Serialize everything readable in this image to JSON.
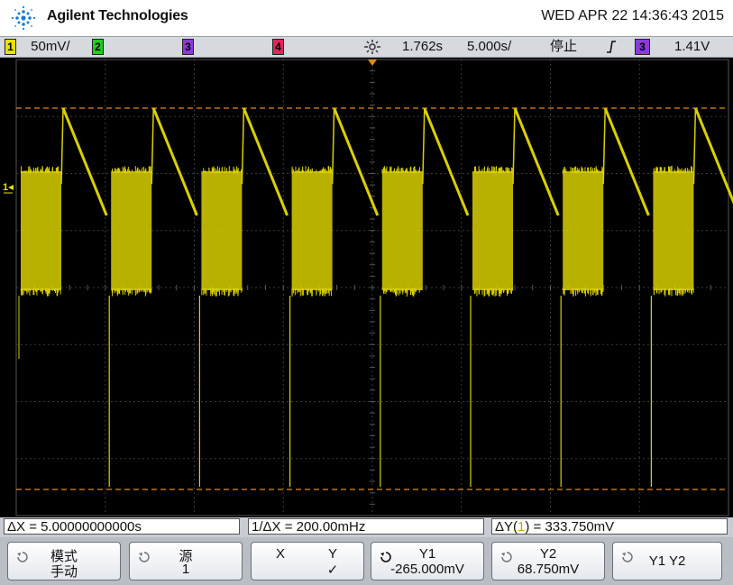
{
  "header": {
    "brand": "Agilent Technologies",
    "datetime": "WED APR 22 14:36:43 2015"
  },
  "statusbar": {
    "ch1": {
      "num": "1",
      "scale": "50mV/"
    },
    "ch2": {
      "num": "2"
    },
    "ch3": {
      "num": "3"
    },
    "ch4": {
      "num": "4"
    },
    "time_delay": "1.762s",
    "time_scale": "5.000s/",
    "run_state": "停止",
    "trigger_slope": "Ⅎ",
    "trigger_source": "3",
    "trigger_level": "1.41V"
  },
  "screen": {
    "ground_marker": "1"
  },
  "measurements": {
    "delta_x": "ΔX = 5.00000000000s",
    "inv_delta_x": "1/ΔX = 200.00mHz",
    "delta_y_prefix": "ΔY(",
    "delta_y_ch": "1",
    "delta_y_suffix": ") = 333.750mV"
  },
  "softkeys": [
    {
      "line1": "模式",
      "line2": "手动"
    },
    {
      "line1": "源",
      "line2": "1"
    },
    {
      "line1": "X",
      "line1b": "Y",
      "line2": "✓"
    },
    {
      "line1": "Y1",
      "line2": "-265.000mV"
    },
    {
      "line1": "Y2",
      "line2": "68.750mV"
    },
    {
      "line1": "Y1 Y2"
    }
  ],
  "colors": {
    "trace": "#d9d000",
    "cursor": "#e08a20",
    "grid": "#3a3a3a"
  }
}
